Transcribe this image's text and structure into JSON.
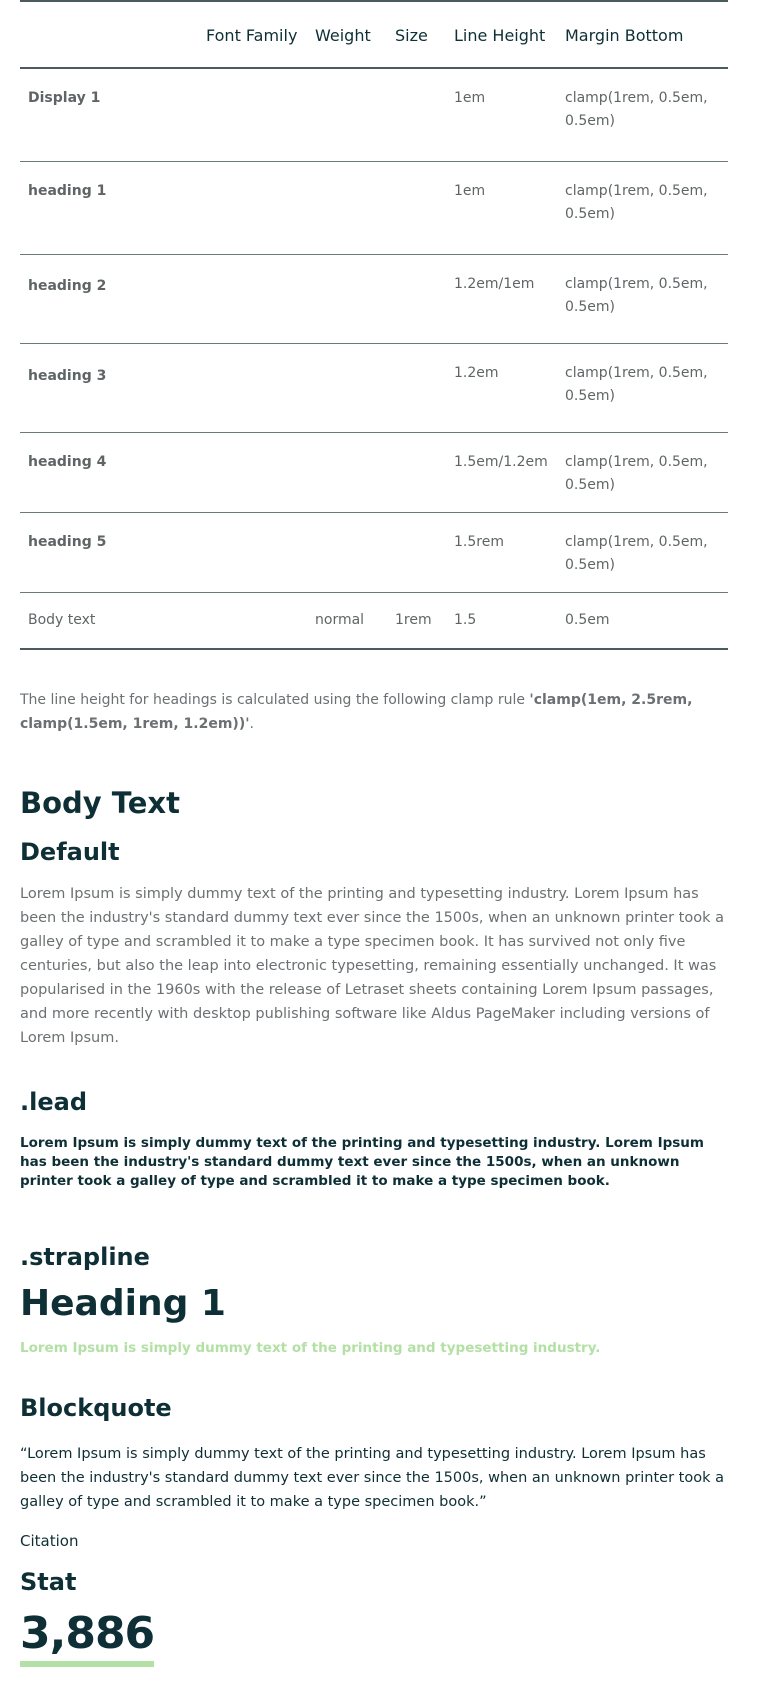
{
  "type_table": {
    "headers": [
      "",
      "Font Family",
      "Weight",
      "Size",
      "Line Height",
      "Margin Bottom"
    ],
    "rows": [
      {
        "name": "Display 1",
        "font_family": "",
        "weight": "",
        "size": "",
        "line_height": "1em",
        "margin_bottom": "clamp(1rem, 0.5em, 0.5em)"
      },
      {
        "name": "heading 1",
        "font_family": "",
        "weight": "",
        "size": "",
        "line_height": "1em",
        "margin_bottom": "clamp(1rem, 0.5em, 0.5em)"
      },
      {
        "name": "heading 2",
        "font_family": "",
        "weight": "",
        "size": "",
        "line_height": "1.2em/1em",
        "margin_bottom": "clamp(1rem, 0.5em, 0.5em)"
      },
      {
        "name": "heading 3",
        "font_family": "",
        "weight": "",
        "size": "",
        "line_height": "1.2em",
        "margin_bottom": "clamp(1rem, 0.5em, 0.5em)"
      },
      {
        "name": "heading 4",
        "font_family": "",
        "weight": "",
        "size": "",
        "line_height": "1.5em/1.2em",
        "margin_bottom": "clamp(1rem, 0.5em, 0.5em)"
      },
      {
        "name": "heading 5",
        "font_family": "",
        "weight": "",
        "size": "",
        "line_height": "1.5rem",
        "margin_bottom": "clamp(1rem, 0.5em, 0.5em)"
      },
      {
        "name": "Body text",
        "font_family": "",
        "weight": "normal",
        "size": "1rem",
        "line_height": "1.5",
        "margin_bottom": "0.5em"
      }
    ]
  },
  "note": {
    "text": "The line height for headings is calculated using the following clamp rule ",
    "rule": "'clamp(1em, 2.5rem, clamp(1.5em, 1rem, 1.2em))'",
    "end": "."
  },
  "body_text": {
    "title": "Body Text",
    "default_title": "Default",
    "default_paragraph": "Lorem Ipsum is simply dummy text of the printing and typesetting industry. Lorem Ipsum has been the industry's standard dummy text ever since the 1500s, when an unknown printer took a galley of type and scrambled it to make a type specimen book. It has survived not only five centuries, but also the leap into electronic typesetting, remaining essentially unchanged. It was popularised in the 1960s with the release of Letraset sheets containing Lorem Ipsum passages, and more recently with desktop publishing software like Aldus PageMaker including versions of Lorem Ipsum.",
    "lead_title": ".lead",
    "lead_paragraph": "Lorem Ipsum is simply dummy text of the printing and typesetting industry. Lorem Ipsum has been the industry's standard dummy text ever since the 1500s, when an unknown printer took a galley of type and scrambled it to make a type specimen book.",
    "strapline_title": ".strapline",
    "strapline_heading": "Heading 1",
    "strapline_text": "Lorem Ipsum is simply dummy text of the printing and typesetting industry.",
    "blockquote_title": "Blockquote",
    "blockquote_text": "“Lorem Ipsum is simply dummy text of the printing and typesetting industry. Lorem Ipsum has been the industry's standard dummy text ever since the 1500s, when an unknown printer took a galley of type and scrambled it to make a type specimen book.”",
    "citation": "Citation",
    "stat_title": "Stat",
    "stat_value": "3,886"
  },
  "colors": {
    "text_dark": "#0d2f35",
    "text_muted": "#6b7072",
    "accent_green": "#b3e0a4"
  }
}
